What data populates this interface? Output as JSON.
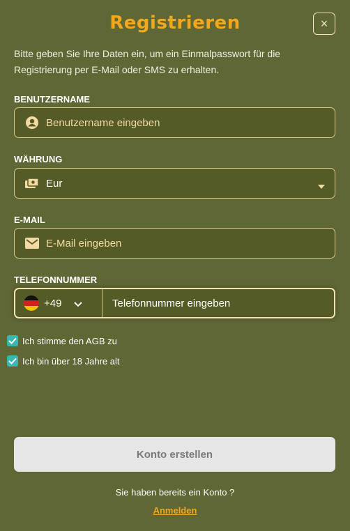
{
  "header": {
    "title": "Registrieren",
    "close_label": "×"
  },
  "intro": "Bitte geben Sie Ihre Daten ein, um ein Einmalpasswort für die Registrierung per E-Mail oder SMS zu erhalten.",
  "form": {
    "username": {
      "label": "BENUTZERNAME",
      "placeholder": "Benutzername eingeben",
      "icon": "user-circle-icon"
    },
    "currency": {
      "label": "WÄHRUNG",
      "value": "Eur",
      "icon": "money-icon"
    },
    "email": {
      "label": "E-MAIL",
      "placeholder": "E-Mail eingeben",
      "icon": "envelope-icon"
    },
    "phone": {
      "label": "TELEFONNUMMER",
      "country_code": "+49",
      "flag": "germany-flag",
      "placeholder": "Telefonnummer eingeben"
    }
  },
  "checks": [
    {
      "label": "Ich stimme den AGB zu",
      "checked": true
    },
    {
      "label": "Ich bin über 18 Jahre alt",
      "checked": true
    }
  ],
  "submit_label": "Konto erstellen",
  "footer": {
    "have_account": "Sie haben bereits ein Konto ?",
    "login_link": "Anmelden"
  },
  "colors": {
    "background": "#5f6734",
    "accent": "#f0a81e",
    "field_bg": "#545b26",
    "field_border": "#d9c98f",
    "checkbox": "#3ab7b0"
  }
}
